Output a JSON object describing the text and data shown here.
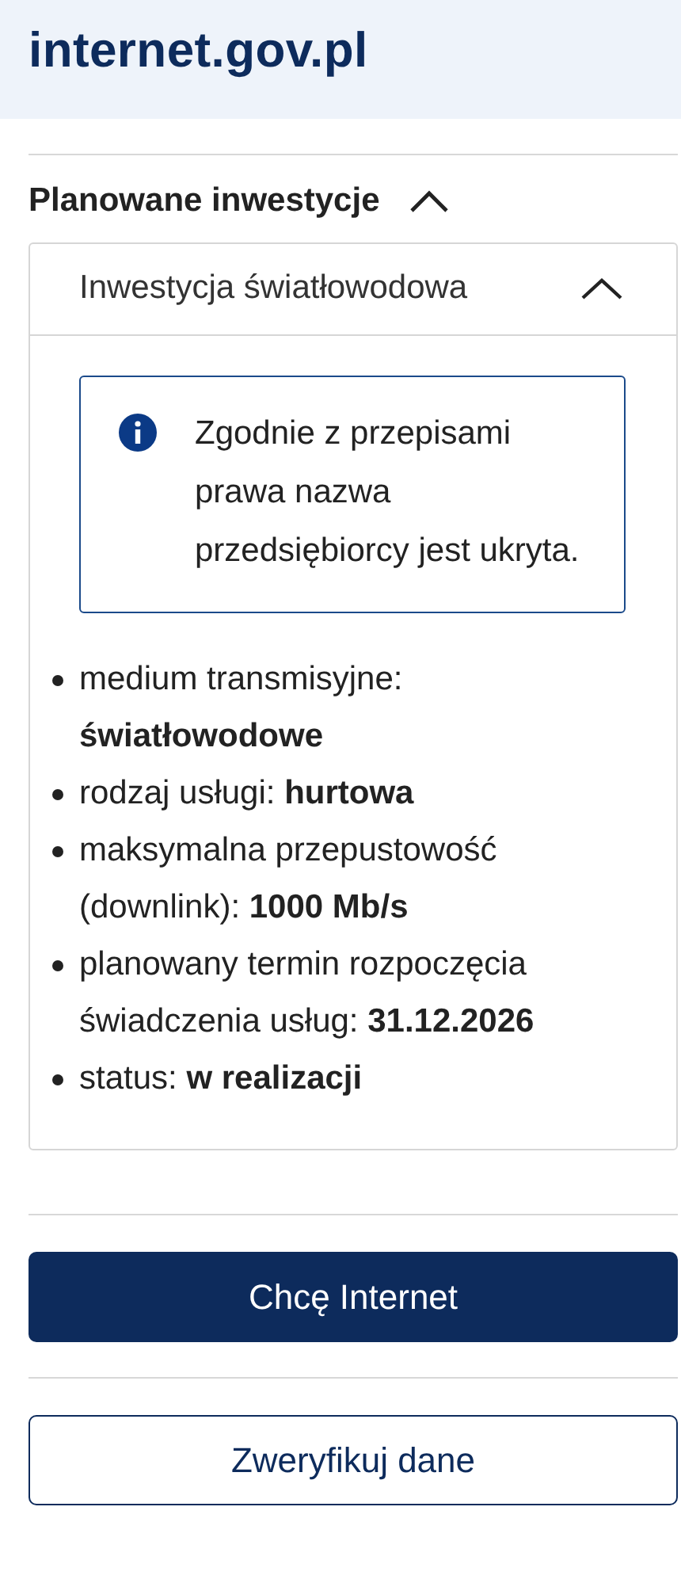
{
  "header": {
    "title": "internet.gov.pl"
  },
  "section": {
    "title": "Planowane inwestycje",
    "expanded": true,
    "investment": {
      "title": "Inwestycja światłowodowa",
      "expanded": true,
      "notice": "Zgodnie z przepisami prawa nazwa przedsiębiorcy jest ukryta.",
      "details": [
        "medium transmisyjne: **światłowodowe**",
        "rodzaj usługi: **hurtowa**",
        "maksymalna przepustowość (downlink): **1000 Mb/s**",
        "planowany termin rozpoczęcia świadczenia usług: **31.12.2026**",
        "status: **w realizacji**"
      ]
    }
  },
  "buttons": [
    {
      "label": "Chcę Internet",
      "kind": "primary"
    },
    {
      "label": "Zweryfikuj dane",
      "kind": "secondary"
    }
  ]
}
